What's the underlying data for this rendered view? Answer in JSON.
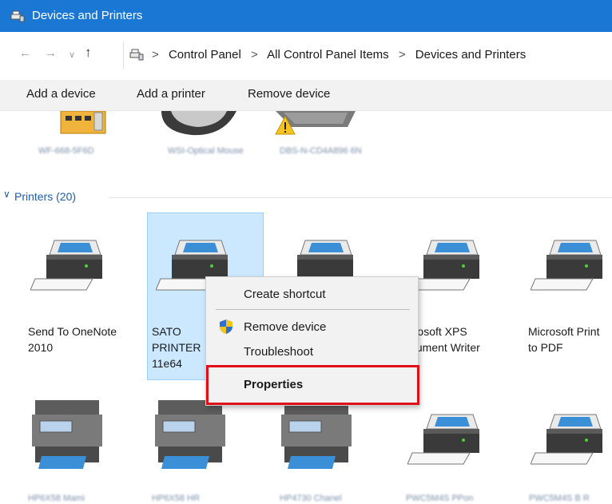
{
  "window": {
    "title": "Devices and Printers",
    "title_icon": "devices-printers-icon"
  },
  "address_bar": {
    "back": "←",
    "forward": "→",
    "recent": "∨",
    "up": "↑",
    "crumbs": [
      "Control Panel",
      "All Control Panel Items",
      "Devices and Printers"
    ],
    "separator": ">"
  },
  "command_bar": {
    "add_device": "Add a device",
    "add_printer": "Add a printer",
    "remove_device": "Remove device"
  },
  "top_devices": [
    {
      "label": "WF-668-5F6D"
    },
    {
      "label": "WSI-Optical Mouse"
    },
    {
      "label": "DBS-N-CD4A896 6N"
    }
  ],
  "printers_group": {
    "header": "Printers (20)",
    "chevron": "∨"
  },
  "printers_row1": [
    {
      "label": "Send To OneNote 2010"
    },
    {
      "label": "SATO PRINTER 11e64",
      "selected": true
    },
    {
      "label": "Microsoft XPS Document Writer"
    },
    {
      "label": "Microsoft Print to PDF"
    }
  ],
  "printers_row2_labels": [
    "HP6X58 Mami",
    "HP6X58 HR",
    "HP4730 Chanel",
    "PWC5M4S PPon",
    "PWC5M4S B R"
  ],
  "context_menu": {
    "create_shortcut": "Create shortcut",
    "remove_device": "Remove device",
    "troubleshoot": "Troubleshoot",
    "properties": "Properties"
  },
  "colors": {
    "title_bar": "#1a78d4",
    "selection": "#cce8ff",
    "highlight_box": "#e0101b"
  }
}
